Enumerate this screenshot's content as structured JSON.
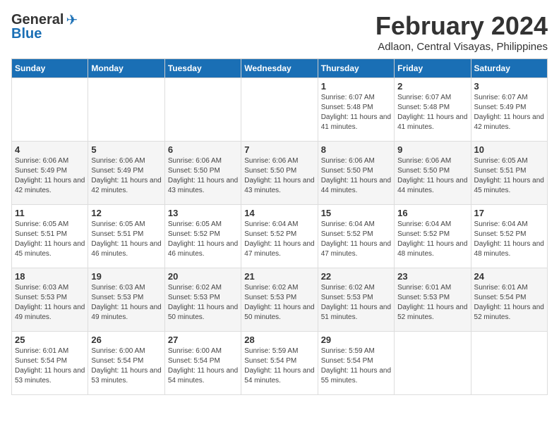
{
  "header": {
    "logo_general": "General",
    "logo_blue": "Blue",
    "title": "February 2024",
    "subtitle": "Adlaon, Central Visayas, Philippines"
  },
  "days_of_week": [
    "Sunday",
    "Monday",
    "Tuesday",
    "Wednesday",
    "Thursday",
    "Friday",
    "Saturday"
  ],
  "weeks": [
    [
      {
        "day": "",
        "data": ""
      },
      {
        "day": "",
        "data": ""
      },
      {
        "day": "",
        "data": ""
      },
      {
        "day": "",
        "data": ""
      },
      {
        "day": "1",
        "sunrise": "6:07 AM",
        "sunset": "5:48 PM",
        "daylight": "11 hours and 41 minutes."
      },
      {
        "day": "2",
        "sunrise": "6:07 AM",
        "sunset": "5:48 PM",
        "daylight": "11 hours and 41 minutes."
      },
      {
        "day": "3",
        "sunrise": "6:07 AM",
        "sunset": "5:49 PM",
        "daylight": "11 hours and 42 minutes."
      }
    ],
    [
      {
        "day": "4",
        "sunrise": "6:06 AM",
        "sunset": "5:49 PM",
        "daylight": "11 hours and 42 minutes."
      },
      {
        "day": "5",
        "sunrise": "6:06 AM",
        "sunset": "5:49 PM",
        "daylight": "11 hours and 42 minutes."
      },
      {
        "day": "6",
        "sunrise": "6:06 AM",
        "sunset": "5:50 PM",
        "daylight": "11 hours and 43 minutes."
      },
      {
        "day": "7",
        "sunrise": "6:06 AM",
        "sunset": "5:50 PM",
        "daylight": "11 hours and 43 minutes."
      },
      {
        "day": "8",
        "sunrise": "6:06 AM",
        "sunset": "5:50 PM",
        "daylight": "11 hours and 44 minutes."
      },
      {
        "day": "9",
        "sunrise": "6:06 AM",
        "sunset": "5:50 PM",
        "daylight": "11 hours and 44 minutes."
      },
      {
        "day": "10",
        "sunrise": "6:05 AM",
        "sunset": "5:51 PM",
        "daylight": "11 hours and 45 minutes."
      }
    ],
    [
      {
        "day": "11",
        "sunrise": "6:05 AM",
        "sunset": "5:51 PM",
        "daylight": "11 hours and 45 minutes."
      },
      {
        "day": "12",
        "sunrise": "6:05 AM",
        "sunset": "5:51 PM",
        "daylight": "11 hours and 46 minutes."
      },
      {
        "day": "13",
        "sunrise": "6:05 AM",
        "sunset": "5:52 PM",
        "daylight": "11 hours and 46 minutes."
      },
      {
        "day": "14",
        "sunrise": "6:04 AM",
        "sunset": "5:52 PM",
        "daylight": "11 hours and 47 minutes."
      },
      {
        "day": "15",
        "sunrise": "6:04 AM",
        "sunset": "5:52 PM",
        "daylight": "11 hours and 47 minutes."
      },
      {
        "day": "16",
        "sunrise": "6:04 AM",
        "sunset": "5:52 PM",
        "daylight": "11 hours and 48 minutes."
      },
      {
        "day": "17",
        "sunrise": "6:04 AM",
        "sunset": "5:52 PM",
        "daylight": "11 hours and 48 minutes."
      }
    ],
    [
      {
        "day": "18",
        "sunrise": "6:03 AM",
        "sunset": "5:53 PM",
        "daylight": "11 hours and 49 minutes."
      },
      {
        "day": "19",
        "sunrise": "6:03 AM",
        "sunset": "5:53 PM",
        "daylight": "11 hours and 49 minutes."
      },
      {
        "day": "20",
        "sunrise": "6:02 AM",
        "sunset": "5:53 PM",
        "daylight": "11 hours and 50 minutes."
      },
      {
        "day": "21",
        "sunrise": "6:02 AM",
        "sunset": "5:53 PM",
        "daylight": "11 hours and 50 minutes."
      },
      {
        "day": "22",
        "sunrise": "6:02 AM",
        "sunset": "5:53 PM",
        "daylight": "11 hours and 51 minutes."
      },
      {
        "day": "23",
        "sunrise": "6:01 AM",
        "sunset": "5:53 PM",
        "daylight": "11 hours and 52 minutes."
      },
      {
        "day": "24",
        "sunrise": "6:01 AM",
        "sunset": "5:54 PM",
        "daylight": "11 hours and 52 minutes."
      }
    ],
    [
      {
        "day": "25",
        "sunrise": "6:01 AM",
        "sunset": "5:54 PM",
        "daylight": "11 hours and 53 minutes."
      },
      {
        "day": "26",
        "sunrise": "6:00 AM",
        "sunset": "5:54 PM",
        "daylight": "11 hours and 53 minutes."
      },
      {
        "day": "27",
        "sunrise": "6:00 AM",
        "sunset": "5:54 PM",
        "daylight": "11 hours and 54 minutes."
      },
      {
        "day": "28",
        "sunrise": "5:59 AM",
        "sunset": "5:54 PM",
        "daylight": "11 hours and 54 minutes."
      },
      {
        "day": "29",
        "sunrise": "5:59 AM",
        "sunset": "5:54 PM",
        "daylight": "11 hours and 55 minutes."
      },
      {
        "day": "",
        "data": ""
      },
      {
        "day": "",
        "data": ""
      }
    ]
  ]
}
